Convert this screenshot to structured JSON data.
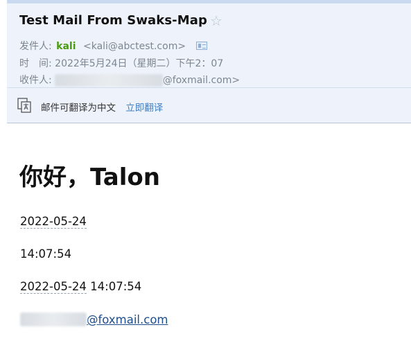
{
  "email": {
    "subject": "Test Mail From Swaks-Map",
    "from_label": "发件人:",
    "sender_name": "kali",
    "sender_email": "<kali@abctest.com>",
    "time_label": "时　间:",
    "time_value": "2022年5月24日（星期二）下午2：07",
    "to_label": "收件人:",
    "to_domain": "@foxmail.com>"
  },
  "translate": {
    "notice": "邮件可翻译为中文",
    "action": "立即翻译"
  },
  "body": {
    "greeting": "你好，Talon",
    "date": "2022-05-24",
    "time": "14:07:54",
    "datetime_date": "2022-05-24",
    "datetime_time": "14:07:54",
    "email_domain": "@foxmail.com"
  },
  "icons": [
    "star-icon",
    "contact-card-icon",
    "translate-icon"
  ]
}
